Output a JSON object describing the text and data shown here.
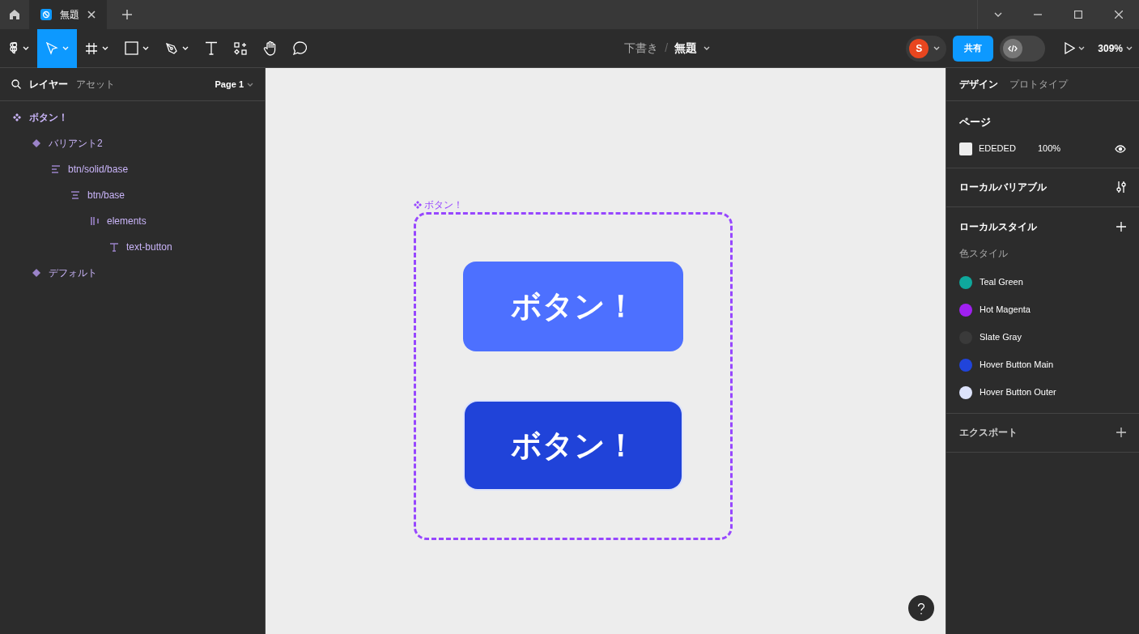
{
  "tab_bar": {
    "tabs": [
      {
        "title": "無題",
        "selected": true
      }
    ]
  },
  "toolbar": {
    "tools": [
      {
        "kind": "logo",
        "has_menu": true,
        "selected": false
      },
      {
        "kind": "move",
        "has_menu": true,
        "selected": true
      },
      {
        "kind": "frame",
        "has_menu": true,
        "selected": false
      },
      {
        "kind": "shape",
        "has_menu": true,
        "selected": false
      },
      {
        "kind": "pen",
        "has_menu": true,
        "selected": false
      },
      {
        "kind": "text",
        "has_menu": false,
        "selected": false
      },
      {
        "kind": "resources",
        "has_menu": false,
        "selected": false
      },
      {
        "kind": "hand",
        "has_menu": false,
        "selected": false
      },
      {
        "kind": "comment",
        "has_menu": false,
        "selected": false
      }
    ],
    "breadcrumb": {
      "folder": "下書き",
      "separator": "/",
      "file": "無題"
    },
    "avatar": "S",
    "share": "共有",
    "dev_mode": {
      "on": false
    },
    "zoom": "309%"
  },
  "layers_panel": {
    "tabs": [
      {
        "label": "レイヤー",
        "selected": true
      },
      {
        "label": "アセット",
        "selected": false
      }
    ],
    "page": "Page 1",
    "layers": [
      {
        "name": "ボタン！",
        "kind": "component-set",
        "children": [
          {
            "name": "バリアント2",
            "kind": "variant",
            "children": [
              {
                "name": "btn/solid/base",
                "kind": "stack-left",
                "children": [
                  {
                    "name": "btn/base",
                    "kind": "stack-center",
                    "children": [
                      {
                        "name": "elements",
                        "kind": "columns",
                        "children": [
                          {
                            "name": "text-button",
                            "kind": "text"
                          }
                        ]
                      }
                    ]
                  }
                ]
              }
            ]
          },
          {
            "name": "デフォルト",
            "kind": "variant"
          }
        ]
      }
    ]
  },
  "canvas": {
    "frame_label": "ボタン！",
    "variants": [
      {
        "label": "ボタン！",
        "kind": "default"
      },
      {
        "label": "ボタン！",
        "kind": "hover"
      }
    ]
  },
  "design_panel": {
    "tabs": [
      {
        "label": "デザイン",
        "selected": true
      },
      {
        "label": "プロトタイプ",
        "selected": false
      }
    ],
    "page": {
      "title": "ページ",
      "fill": "EDEDED",
      "opacity": "100%"
    },
    "local_variables": "ローカルバリアブル",
    "local_styles": "ローカルスタイル",
    "color_styles_title": "色スタイル",
    "color_styles": [
      {
        "name": "Teal Green",
        "color": "#0fa89c"
      },
      {
        "name": "Hot Magenta",
        "color": "#a020f0"
      },
      {
        "name": "Slate Gray",
        "color": "#3a3a3a"
      },
      {
        "name": "Hover Button Main",
        "color": "#2044db"
      },
      {
        "name": "Hover Button Outer",
        "color": "#dde3fb"
      }
    ],
    "export": "エクスポート"
  }
}
